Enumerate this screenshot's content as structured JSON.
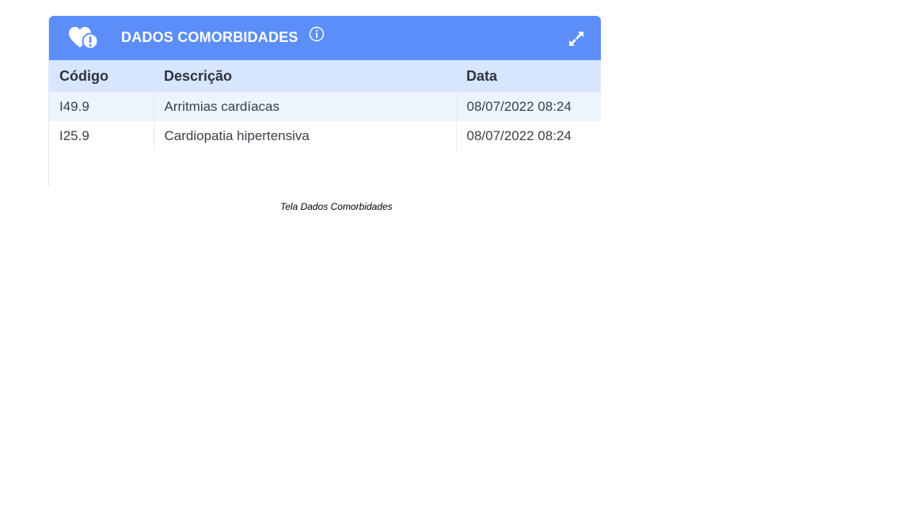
{
  "panel": {
    "title": "DADOS COMORBIDADES",
    "header_icon": "heart-alert-icon",
    "info_icon": "info-icon",
    "expand_icon": "expand-icon",
    "colors": {
      "header_bg": "#5c8ef9",
      "table_header_bg": "#d8e6fd",
      "striped_row_bg": "#eef4fd"
    }
  },
  "table": {
    "columns": [
      "Código",
      "Descrição",
      "Data"
    ],
    "rows": [
      {
        "codigo": "I49.9",
        "descricao": "Arritmias cardíacas",
        "data": "08/07/2022 08:24"
      },
      {
        "codigo": "I25.9",
        "descricao": "Cardiopatia hipertensiva",
        "data": "08/07/2022 08:24"
      }
    ]
  },
  "caption": "Tela Dados Comorbidades"
}
